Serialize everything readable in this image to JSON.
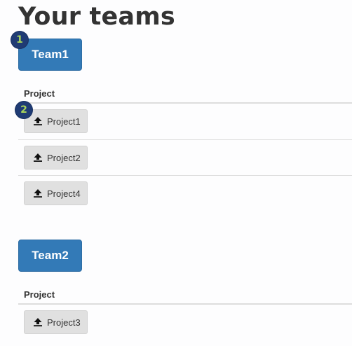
{
  "page": {
    "title": "Your teams"
  },
  "teams": [
    {
      "name": "Team1",
      "project_header": "Project",
      "projects": [
        "Project1",
        "Project2",
        "Project4"
      ]
    },
    {
      "name": "Team2",
      "project_header": "Project",
      "projects": [
        "Project3"
      ]
    }
  ],
  "annotations": {
    "badge_1": "1",
    "badge_2": "2"
  },
  "icons": {
    "project_button_icon": "upload-icon"
  },
  "colors": {
    "team_button": "#337ab7",
    "project_button": "#e0e0e0",
    "badge_bg": "#1f3b74",
    "badge_text": "#a8d45b"
  }
}
